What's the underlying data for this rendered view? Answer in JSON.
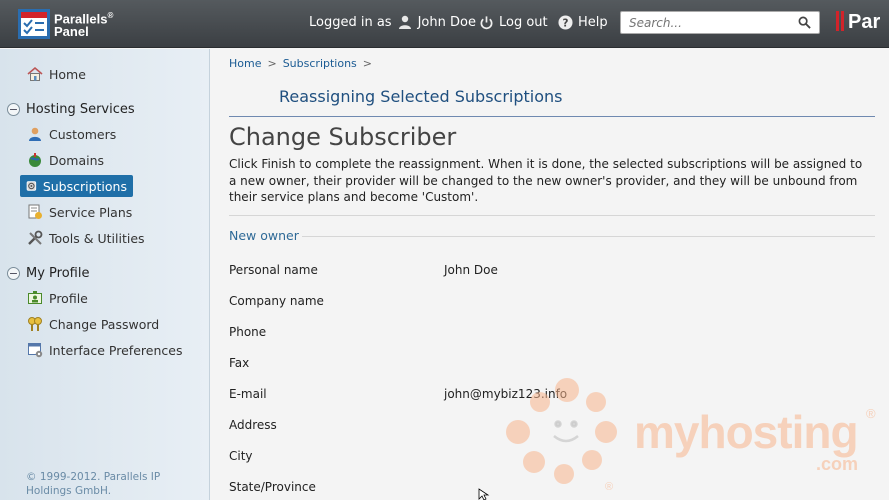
{
  "header": {
    "brand_line1": "Parallels",
    "brand_reg": "®",
    "brand_line2": "Panel",
    "logged_in_label": "Logged in as",
    "user_name": "John Doe",
    "logout_label": "Log out",
    "help_label": "Help",
    "search_placeholder": "Search...",
    "brand_right": "Par"
  },
  "sidebar": {
    "home": "Home",
    "hosting_group": "Hosting Services",
    "items": [
      {
        "label": "Customers",
        "icon": "customers-icon"
      },
      {
        "label": "Domains",
        "icon": "domains-icon"
      },
      {
        "label": "Subscriptions",
        "icon": "subscriptions-icon",
        "active": true
      },
      {
        "label": "Service Plans",
        "icon": "service-plans-icon"
      },
      {
        "label": "Tools & Utilities",
        "icon": "tools-icon"
      }
    ],
    "profile_group": "My Profile",
    "profile_items": [
      {
        "label": "Profile",
        "icon": "profile-icon"
      },
      {
        "label": "Change Password",
        "icon": "key-icon"
      },
      {
        "label": "Interface Preferences",
        "icon": "preferences-icon"
      }
    ],
    "copyright": "© 1999-2012. Parallels IP Holdings GmbH."
  },
  "breadcrumb": [
    "Home",
    "Subscriptions"
  ],
  "page": {
    "subtitle": "Reassigning Selected Subscriptions",
    "title": "Change Subscriber",
    "description": "Click Finish to complete the reassignment. When it is done, the selected subscriptions will be assigned to a new owner, their provider will be changed to the new owner's provider, and they will be unbound from their service plans and become 'Custom'.",
    "section": "New owner",
    "fields": [
      {
        "label": "Personal name",
        "value": "John Doe"
      },
      {
        "label": "Company name",
        "value": ""
      },
      {
        "label": "Phone",
        "value": ""
      },
      {
        "label": "Fax",
        "value": ""
      },
      {
        "label": "E-mail",
        "value": "john@mybiz123.info"
      },
      {
        "label": "Address",
        "value": ""
      },
      {
        "label": "City",
        "value": ""
      },
      {
        "label": "State/Province",
        "value": ""
      }
    ]
  },
  "watermark": {
    "text": "myhosting",
    "sub": ".com",
    "reg": "®"
  },
  "colors": {
    "accent": "#1f6fa8",
    "header": "#45494d",
    "link": "#1b5b93"
  }
}
